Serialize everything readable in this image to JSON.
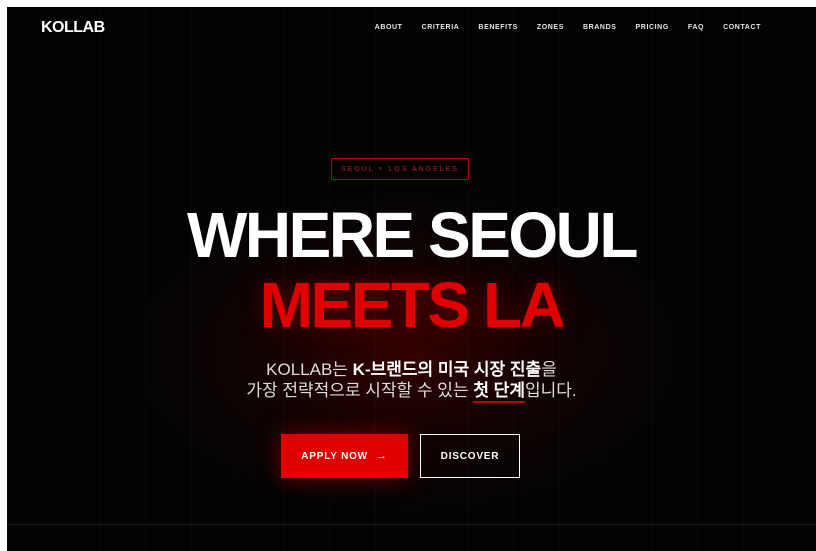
{
  "brand": {
    "logo": "KOLLAB"
  },
  "nav": {
    "items": [
      "ABOUT",
      "CRITERIA",
      "BENEFITS",
      "ZONES",
      "BRANDS",
      "PRICING",
      "FAQ",
      "CONTACT"
    ]
  },
  "hero": {
    "tagline": "SEOUL × LOS ANGELES",
    "headline_line1": "WHERE SEOUL",
    "headline_line2": "MEETS LA",
    "sub": {
      "l1_a": "KOLLAB는 ",
      "l1_b": "K-브랜드의 미국 시장 진출",
      "l1_c": "을",
      "l2_a": "가장 전략적으로 시작할 수 있는 ",
      "l2_b": "첫 단계",
      "l2_c": "입니다."
    },
    "apply_label": "APPLY NOW",
    "apply_arrow": "→",
    "discover_label": "DISCOVER"
  },
  "colors": {
    "background": "#030303",
    "accent": "#e00000",
    "text": "#ffffff"
  },
  "icons": {
    "apply_arrow": "arrow-right-icon"
  }
}
